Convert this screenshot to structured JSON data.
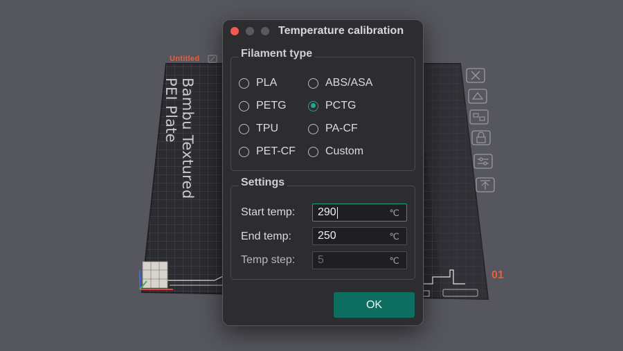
{
  "background": {
    "plate_label": "Untitled",
    "plate_name": "Bambu Textured PEI Plate",
    "plate_number": "01",
    "tools": [
      "close-icon",
      "auto-arrange-icon",
      "orient-icon",
      "lock-icon",
      "settings-icon",
      "move-up-icon"
    ]
  },
  "dialog": {
    "title": "Temperature calibration",
    "filament_group": {
      "title": "Filament type",
      "options": [
        "PLA",
        "ABS/ASA",
        "PETG",
        "PCTG",
        "TPU",
        "PA-CF",
        "PET-CF",
        "Custom"
      ],
      "selected": "PCTG"
    },
    "settings_group": {
      "title": "Settings",
      "start_temp": {
        "label": "Start temp:",
        "value": "290",
        "unit": "℃"
      },
      "end_temp": {
        "label": "End temp:",
        "value": "250",
        "unit": "℃"
      },
      "temp_step": {
        "label": "Temp step:",
        "value": "5",
        "unit": "℃"
      }
    },
    "ok_label": "OK"
  },
  "colors": {
    "accent": "#27a48d",
    "ok_button": "#0d6e5f",
    "close_button": "#f05a50",
    "plate_label": "#e2613f"
  }
}
